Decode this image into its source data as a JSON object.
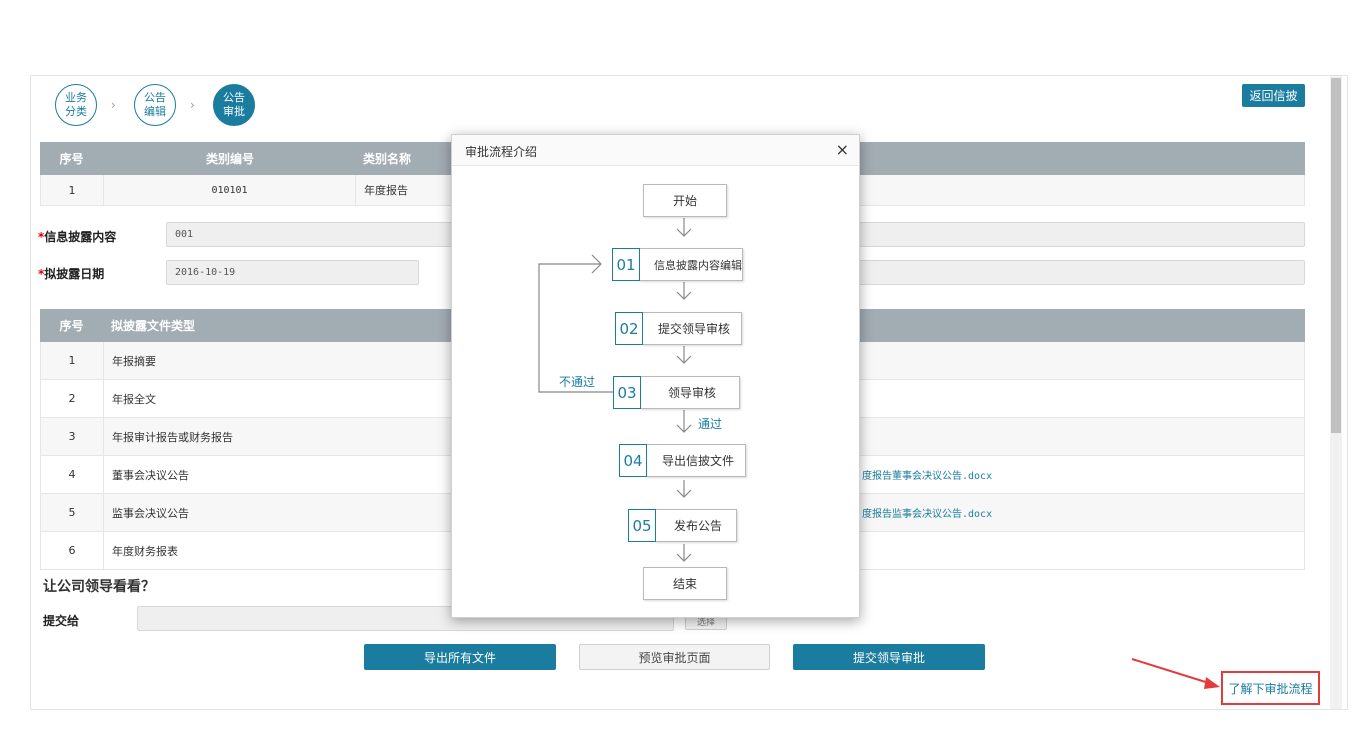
{
  "steps": [
    {
      "label": "业务分类",
      "active": false
    },
    {
      "label": "公告编辑",
      "active": false
    },
    {
      "label": "公告审批",
      "active": true
    }
  ],
  "step_separator": "›",
  "return_button": "返回信披",
  "category_table": {
    "headers": [
      "序号",
      "类别编号",
      "类别名称"
    ],
    "rows": [
      {
        "index": "1",
        "code": "010101",
        "name": "年度报告"
      }
    ]
  },
  "form": {
    "content_label": "信息披露内容",
    "content_value": "001",
    "date_label": "拟披露日期",
    "date_value": "2016-10-19",
    "required_mark": "*"
  },
  "file_table": {
    "headers": [
      "序号",
      "拟披露文件类型"
    ],
    "rows": [
      {
        "index": "1",
        "type": "年报摘要",
        "file": ""
      },
      {
        "index": "2",
        "type": "年报全文",
        "file": ""
      },
      {
        "index": "3",
        "type": "年报审计报告或财务报告",
        "file": ""
      },
      {
        "index": "4",
        "type": "董事会决议公告",
        "file": "度报告董事会决议公告.docx"
      },
      {
        "index": "5",
        "type": "监事会决议公告",
        "file": "度报告监事会决议公告.docx"
      },
      {
        "index": "6",
        "type": "年度财务报表",
        "file": ""
      }
    ]
  },
  "review": {
    "title": "让公司领导看看？",
    "submit_to_label": "提交给",
    "select_button": "选择"
  },
  "actions": {
    "export_all": "导出所有文件",
    "preview": "预览审批页面",
    "submit": "提交领导审批"
  },
  "learn_link": "了解下审批流程",
  "modal": {
    "title": "审批流程介绍",
    "close": "×",
    "start": "开始",
    "end": "结束",
    "flow": [
      {
        "num": "01",
        "label": "信息披露内容编辑"
      },
      {
        "num": "02",
        "label": "提交领导审核"
      },
      {
        "num": "03",
        "label": "领导审核"
      },
      {
        "num": "04",
        "label": "导出信披文件"
      },
      {
        "num": "05",
        "label": "发布公告"
      }
    ],
    "reject_label": "不通过",
    "pass_label": "通过"
  },
  "colors": {
    "accent": "#1a7c9e",
    "header_gray": "#a2acb3",
    "highlight_red": "#e33c3c"
  }
}
